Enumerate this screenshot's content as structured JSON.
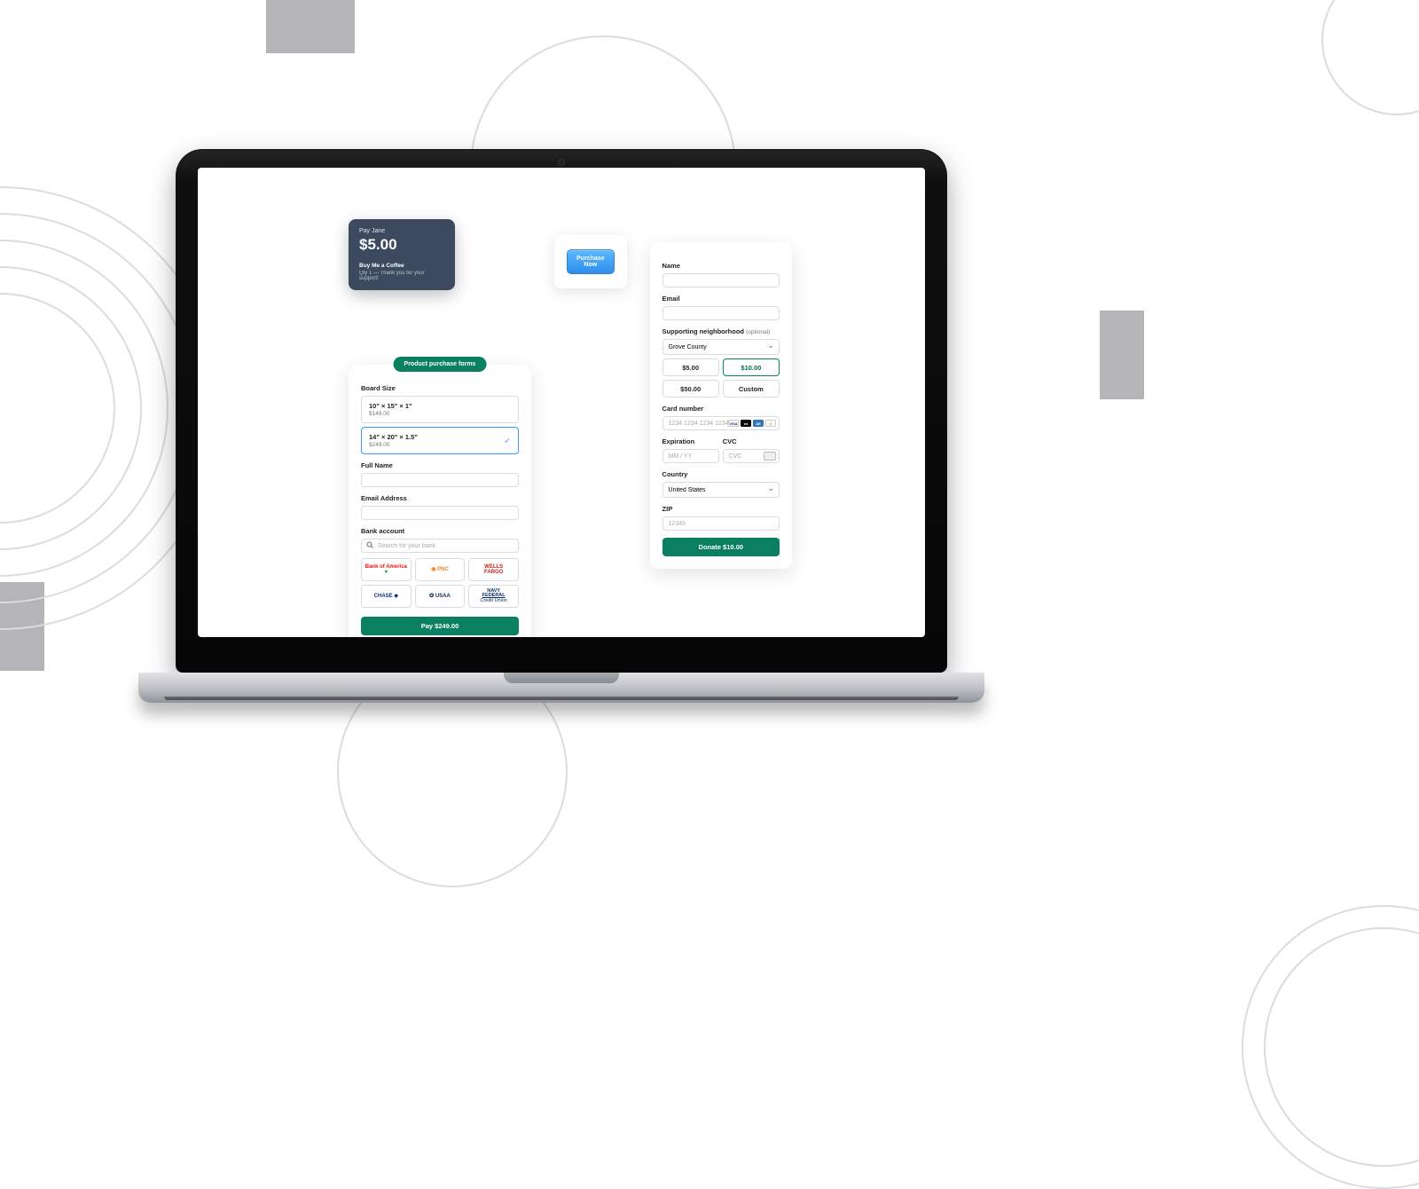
{
  "pay_card": {
    "title": "Pay Jane",
    "amount": "$5.00",
    "item": "Buy Me a Coffee",
    "fine": "Qty 1 — Thank you for your support!"
  },
  "purchase_btn": "Purchase Now",
  "pill": "Product purchase forms",
  "product": {
    "size_label": "Board Size",
    "options": [
      {
        "title": "10\" × 15\" × 1\"",
        "price": "$149.00",
        "selected": false
      },
      {
        "title": "14\" × 20\" × 1.5\"",
        "price": "$249.00",
        "selected": true
      }
    ],
    "name_label": "Full Name",
    "email_label": "Email Address",
    "bank_label": "Bank account",
    "bank_search_ph": "Search for your bank",
    "banks": [
      "Bank of America",
      "PNC",
      "WELLS FARGO",
      "CHASE",
      "USAA",
      "NAVY FEDERAL Credit Union"
    ],
    "pay_label": "Pay $249.00"
  },
  "donate": {
    "name_label": "Name",
    "email_label": "Email",
    "neighborhood_label": "Supporting neighborhood",
    "neighborhood_optional": "(optional)",
    "neighborhood_value": "Grove County",
    "amounts": [
      "$5.00",
      "$10.00",
      "$50.00",
      "Custom"
    ],
    "selected_amount": 1,
    "card_label": "Card number",
    "card_ph": "1234 1234 1234 1234",
    "exp_label": "Expiration",
    "exp_ph": "MM / YY",
    "cvc_label": "CVC",
    "cvc_ph": "CVC",
    "country_label": "Country",
    "country_value": "United States",
    "zip_label": "ZIP",
    "zip_ph": "12345",
    "donate_label": "Donate $10.00"
  }
}
